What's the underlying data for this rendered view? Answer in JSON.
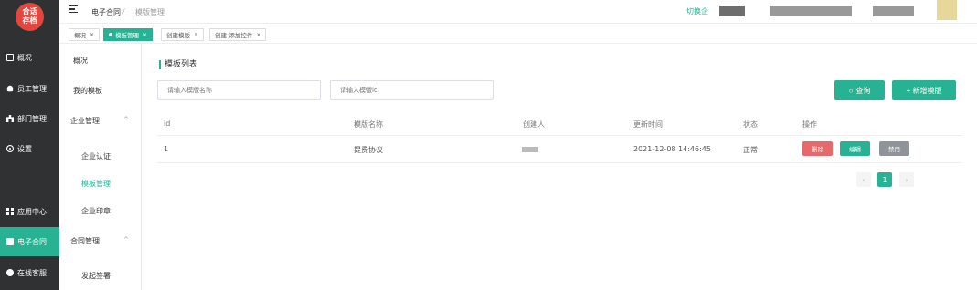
{
  "logo": {
    "line1": "合话",
    "line2": "存档"
  },
  "sidebar": {
    "items": [
      {
        "label": "概况"
      },
      {
        "label": "员工管理"
      },
      {
        "label": "部门管理"
      },
      {
        "label": "设置"
      },
      {
        "label": "应用中心"
      },
      {
        "label": "电子合同",
        "active": true
      },
      {
        "label": "在线客服"
      }
    ]
  },
  "submenu": {
    "overview": "概况",
    "my_templates": "我的模板",
    "enterprise_mgmt": "企业管理",
    "enterprise_auth": "企业认证",
    "template_mgmt": "模板管理",
    "enterprise_seal": "企业印章",
    "contract_mgmt": "合同管理",
    "initiate_sign": "发起签署",
    "chevron_up": "^",
    "chevron_up2": "^"
  },
  "header": {
    "breadcrumb1": "电子合同",
    "separator": "/",
    "breadcrumb2": "模版管理",
    "switch_label": "切换企"
  },
  "tags": [
    {
      "label": "概况",
      "close": "×"
    },
    {
      "label": "模板管理",
      "close": "×",
      "active": true
    },
    {
      "label": "创建模版",
      "close": "×"
    },
    {
      "label": "创建-添加控件",
      "close": "×"
    }
  ],
  "main": {
    "title": "模板列表",
    "search_name_placeholder": "请输入模版名称",
    "search_id_placeholder": "请输入模版id",
    "query_label": "查询",
    "add_label": "+ 新增模版"
  },
  "table": {
    "headers": {
      "id": "id",
      "name": "模版名称",
      "creator": "创建人",
      "updated": "更新时间",
      "status": "状态",
      "actions": "操作"
    },
    "rows": [
      {
        "id": "1",
        "name": "提费协议",
        "updated": "2021-12-08 14:46:45",
        "status": "正常",
        "delete": "删除",
        "edit": "编辑",
        "disable": "禁用"
      }
    ]
  },
  "pagination": {
    "prev": "‹",
    "current": "1",
    "next": "›"
  },
  "colors": {
    "accent": "#27b293",
    "danger": "#e86969",
    "sidebar": "#303133",
    "disabled": "#909399"
  }
}
